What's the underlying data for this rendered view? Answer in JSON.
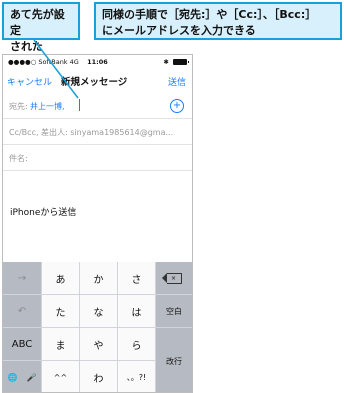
{
  "callouts": {
    "left": "あて先が設定\nされた",
    "right": "同様の手順で［宛先:］や［Cc:］、［Bcc:］\nにメールアドレスを入力できる"
  },
  "status": {
    "carrier": "●●●●○ SoftBank  4G",
    "time": "11:06",
    "bt": "✱"
  },
  "nav": {
    "cancel": "キャンセル",
    "title": "新規メッセージ",
    "send": "送信"
  },
  "compose": {
    "to_label": "宛先:",
    "to_value": "井上一博,",
    "cc_label": "Cc/Bcc, 差出人: sinyama1985614@gma...",
    "subject_label": "件名:",
    "body": "iPhoneから送信"
  },
  "keyboard": {
    "row1": [
      "→",
      "あ",
      "か",
      "さ",
      "⌫"
    ],
    "row2": [
      "↶",
      "た",
      "な",
      "は"
    ],
    "row3": [
      "ABC",
      "ま",
      "や",
      "ら"
    ],
    "row4": [
      "🌐",
      "🎤",
      "^^",
      "わ",
      "、。?!"
    ],
    "space": "空白",
    "return": "改行"
  },
  "colors": {
    "callout_border": "#1aa0d8",
    "callout_bg": "#d8f0fb",
    "ios_blue": "#1a7cff"
  }
}
